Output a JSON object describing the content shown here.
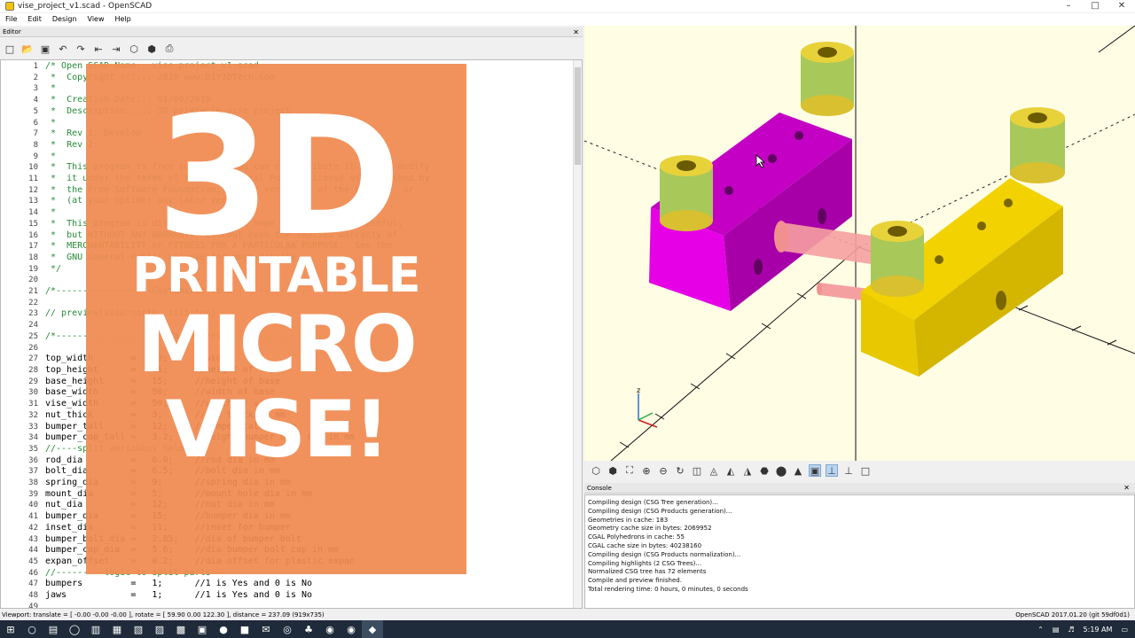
{
  "window": {
    "title": "vise_project_v1.scad - OpenSCAD"
  },
  "menu": [
    "File",
    "Edit",
    "Design",
    "View",
    "Help"
  ],
  "editor": {
    "panel_title": "Editor",
    "lines": [
      {
        "n": "1",
        "t": "/* Open SCAD Name.: vise_project_v1.scad",
        "c": true
      },
      {
        "n": "2",
        "t": " *  Copyright (c)..: 2019 www.DIY3DTech.com",
        "c": true
      },
      {
        "n": "3",
        "t": " *",
        "c": true
      },
      {
        "n": "4",
        "t": " *  Creation Date..: 01/09/2019",
        "c": true
      },
      {
        "n": "5",
        "t": " *  Description....: 3D printable vise project",
        "c": true
      },
      {
        "n": "6",
        "t": " *",
        "c": true
      },
      {
        "n": "7",
        "t": " *  Rev 1: Develop",
        "c": true
      },
      {
        "n": "8",
        "t": " *  Rev 2:",
        "c": true
      },
      {
        "n": "9",
        "t": " *",
        "c": true
      },
      {
        "n": "10",
        "t": " *  This program is free software; you can redistribute it and/or modify",
        "c": true
      },
      {
        "n": "11",
        "t": " *  it under the terms of the GNU General Public License as published by",
        "c": true
      },
      {
        "n": "12",
        "t": " *  the Free Software Foundation; either version 2 of the License, or",
        "c": true
      },
      {
        "n": "13",
        "t": " *  (at your option) any later version.",
        "c": true
      },
      {
        "n": "14",
        "t": " *",
        "c": true
      },
      {
        "n": "15",
        "t": " *  This program is distributed in the hope that it will be useful,",
        "c": true
      },
      {
        "n": "16",
        "t": " *  but WITHOUT ANY WARRANTY; without even the implied warranty of",
        "c": true
      },
      {
        "n": "17",
        "t": " *  MERCHANTABILITY or FITNESS FOR A PARTICULAR PURPOSE.  See the",
        "c": true
      },
      {
        "n": "18",
        "t": " *  GNU General Public License for more details.",
        "c": true
      },
      {
        "n": "19",
        "t": " */",
        "c": true
      },
      {
        "n": "20",
        "t": "",
        "c": false
      },
      {
        "n": "21",
        "t": "/*------------------Customizer View-------------------*/",
        "c": true
      },
      {
        "n": "22",
        "t": "",
        "c": false
      },
      {
        "n": "23",
        "t": "// preview[view:north, tilt:top]",
        "c": true
      },
      {
        "n": "24",
        "t": "",
        "c": false
      },
      {
        "n": "25",
        "t": "/*---------------------Parameters---------------------*/",
        "c": true
      },
      {
        "n": "26",
        "t": "",
        "c": false
      },
      {
        "n": "27",
        "t": "top_width       =   50;     //width",
        "c": false
      },
      {
        "n": "28",
        "t": "top_height      =   15;     //height of top",
        "c": false
      },
      {
        "n": "29",
        "t": "base_height     =   15;     //height of base",
        "c": false
      },
      {
        "n": "30",
        "t": "base_width      =   50;     //width of base",
        "c": false
      },
      {
        "n": "31",
        "t": "vise_width      =   50;     //width of vise",
        "c": false
      },
      {
        "n": "32",
        "t": "nut_thick       =   3;      //nut thick in mm",
        "c": false
      },
      {
        "n": "33",
        "t": "bumper_tall     =   12;     //bumper tall in mm",
        "c": false
      },
      {
        "n": "34",
        "t": "bumper_cap_tall =   3.2;    //height bumper bolt cap in mm",
        "c": false
      },
      {
        "n": "35",
        "t": "//----split variables below----",
        "c": true
      },
      {
        "n": "36",
        "t": "rod_dia         =   6.0;    //rod dia in mm",
        "c": false
      },
      {
        "n": "37",
        "t": "bolt_dia        =   6.5;    //bolt dia in mm",
        "c": false
      },
      {
        "n": "38",
        "t": "spring_dia      =   9;      //spring dia in mm",
        "c": false
      },
      {
        "n": "39",
        "t": "mount_dia       =   5;      //mount hole dia in mm",
        "c": false
      },
      {
        "n": "40",
        "t": "nut_dia         =   12;     //nut dia in mm",
        "c": false
      },
      {
        "n": "41",
        "t": "bumper_dia      =   15;     //bumper dia in mm",
        "c": false
      },
      {
        "n": "42",
        "t": "inset_dia       =   11;     //inset for bumper",
        "c": false
      },
      {
        "n": "43",
        "t": "bumper_bolt_dia =   2.85;   //dia of bumper bolt",
        "c": false
      },
      {
        "n": "44",
        "t": "bumper_cap_dia  =   5.6;    //dia bumper bolt cap in mm",
        "c": false
      },
      {
        "n": "45",
        "t": "expan_offset    =   0.2;    //dia offset for plastic expan",
        "c": false
      },
      {
        "n": "46",
        "t": "//---------logic to split parts-----",
        "c": true
      },
      {
        "n": "47",
        "t": "bumpers         =   1;      //1 is Yes and 0 is No",
        "c": false
      },
      {
        "n": "48",
        "t": "jaws            =   1;      //1 is Yes and 0 is No",
        "c": false
      },
      {
        "n": "49",
        "t": "",
        "c": false
      }
    ]
  },
  "overlay": {
    "line1": "3D",
    "line2": "PRINTABLE",
    "line3": "MICRO",
    "line4": "VISE!"
  },
  "viewport": {
    "axis_z_label": "z",
    "colors": {
      "jaw_left": "#e600e6",
      "jaw_right": "#f2d200",
      "bumper": "#e8d23a",
      "spring": "#a8c85a",
      "rod": "#f5a0a0",
      "background": "#fffde4"
    }
  },
  "console": {
    "panel_title": "Console",
    "lines": [
      "Compiling design (CSG Tree generation)...",
      "Compiling design (CSG Products generation)...",
      "Geometries in cache: 183",
      "Geometry cache size in bytes: 2069952",
      "CGAL Polyhedrons in cache: 55",
      "CGAL cache size in bytes: 40238160",
      "Compiling design (CSG Products normalization)...",
      "Compiling highlights (2 CSG Trees)...",
      "Normalized CSG tree has 72 elements",
      "Compile and preview finished.",
      "Total rendering time: 0 hours, 0 minutes, 0 seconds"
    ]
  },
  "status": {
    "left": "Viewport: translate = [ -0.00 -0.00 -0.00 ], rotate = [ 59.90 0.00 122.30 ], distance = 237.09 (919x735)",
    "right": "OpenSCAD 2017.01.20 (git 59df0d1)"
  },
  "taskbar": {
    "time": "5:19 AM"
  }
}
